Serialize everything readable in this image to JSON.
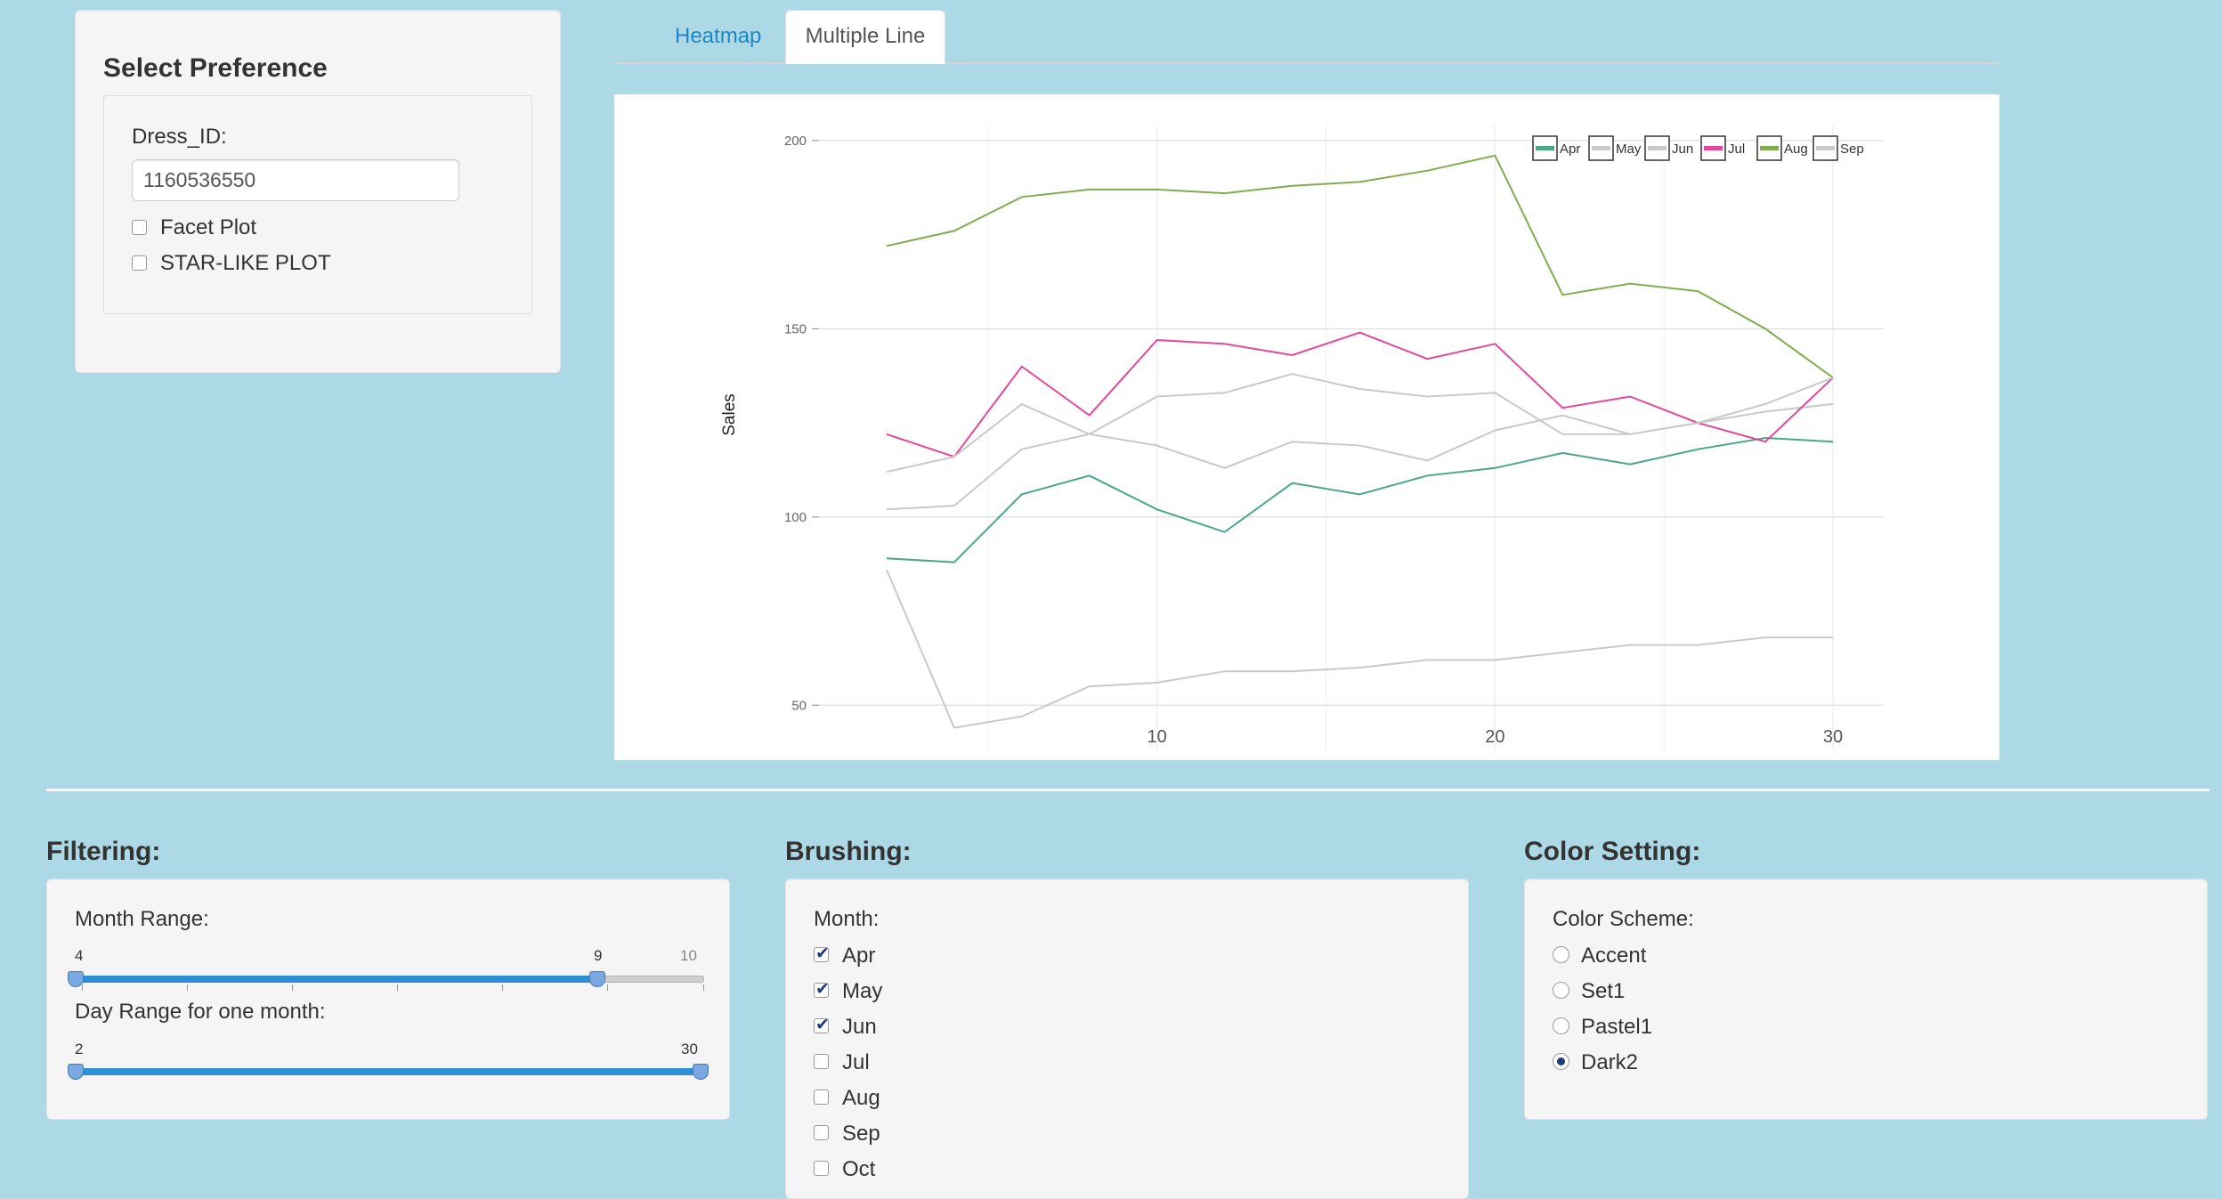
{
  "preference": {
    "title": "Select Preference",
    "dress_id_label": "Dress_ID:",
    "dress_id_value": "1160536550",
    "facet_plot_label": "Facet Plot",
    "star_plot_label": "STAR-LIKE PLOT"
  },
  "tabs": [
    {
      "label": "Heatmap",
      "active": false
    },
    {
      "label": "Multiple Line",
      "active": true
    }
  ],
  "chart_data": {
    "type": "line",
    "title": "",
    "xlabel": "",
    "ylabel": "Sales",
    "xlim": [
      0,
      31.5
    ],
    "ylim": [
      38,
      204
    ],
    "x_ticks": [
      10,
      20,
      30
    ],
    "y_ticks": [
      50,
      100,
      150,
      200
    ],
    "legend_position": "top-right",
    "grid": true,
    "x": [
      2,
      4,
      6,
      8,
      10,
      12,
      14,
      16,
      18,
      20,
      22,
      24,
      26,
      28,
      30
    ],
    "series": [
      {
        "name": "Apr",
        "color": "#4aa886",
        "values": [
          89,
          88,
          106,
          111,
          102,
          96,
          109,
          106,
          111,
          113,
          117,
          114,
          118,
          121,
          120
        ]
      },
      {
        "name": "May",
        "color": "#c9c9c9",
        "values": [
          86,
          44,
          47,
          55,
          56,
          59,
          59,
          60,
          62,
          62,
          64,
          66,
          66,
          68,
          68
        ]
      },
      {
        "name": "Jun",
        "color": "#c9c9c9",
        "values": [
          102,
          103,
          118,
          122,
          119,
          113,
          120,
          119,
          115,
          123,
          127,
          122,
          125,
          128,
          130
        ]
      },
      {
        "name": "Jul",
        "color": "#e4489a",
        "values": [
          122,
          116,
          140,
          127,
          147,
          146,
          143,
          149,
          142,
          146,
          129,
          132,
          125,
          120,
          137
        ]
      },
      {
        "name": "Aug",
        "color": "#7fad4e",
        "values": [
          172,
          176,
          185,
          187,
          187,
          186,
          188,
          189,
          192,
          196,
          159,
          162,
          160,
          150,
          137
        ]
      },
      {
        "name": "Sep",
        "color": "#c9c9c9",
        "values": [
          112,
          116,
          130,
          122,
          132,
          133,
          138,
          134,
          132,
          133,
          122,
          122,
          125,
          130,
          137
        ]
      }
    ]
  },
  "filtering": {
    "title": "Filtering:",
    "month_range_label": "Month Range:",
    "month_min": "4",
    "month_max": "9",
    "month_grid_max": "10",
    "day_range_label": "Day Range for one month:",
    "day_min": "2",
    "day_max": "30"
  },
  "brushing": {
    "title": "Brushing:",
    "month_label": "Month:",
    "months": [
      {
        "label": "Apr",
        "checked": true
      },
      {
        "label": "May",
        "checked": true
      },
      {
        "label": "Jun",
        "checked": true
      },
      {
        "label": "Jul",
        "checked": false
      },
      {
        "label": "Aug",
        "checked": false
      },
      {
        "label": "Sep",
        "checked": false
      },
      {
        "label": "Oct",
        "checked": false
      }
    ]
  },
  "color_setting": {
    "title": "Color Setting:",
    "scheme_label": "Color Scheme:",
    "schemes": [
      {
        "label": "Accent",
        "selected": false
      },
      {
        "label": "Set1",
        "selected": false
      },
      {
        "label": "Pastel1",
        "selected": false
      },
      {
        "label": "Dark2",
        "selected": true
      }
    ]
  }
}
